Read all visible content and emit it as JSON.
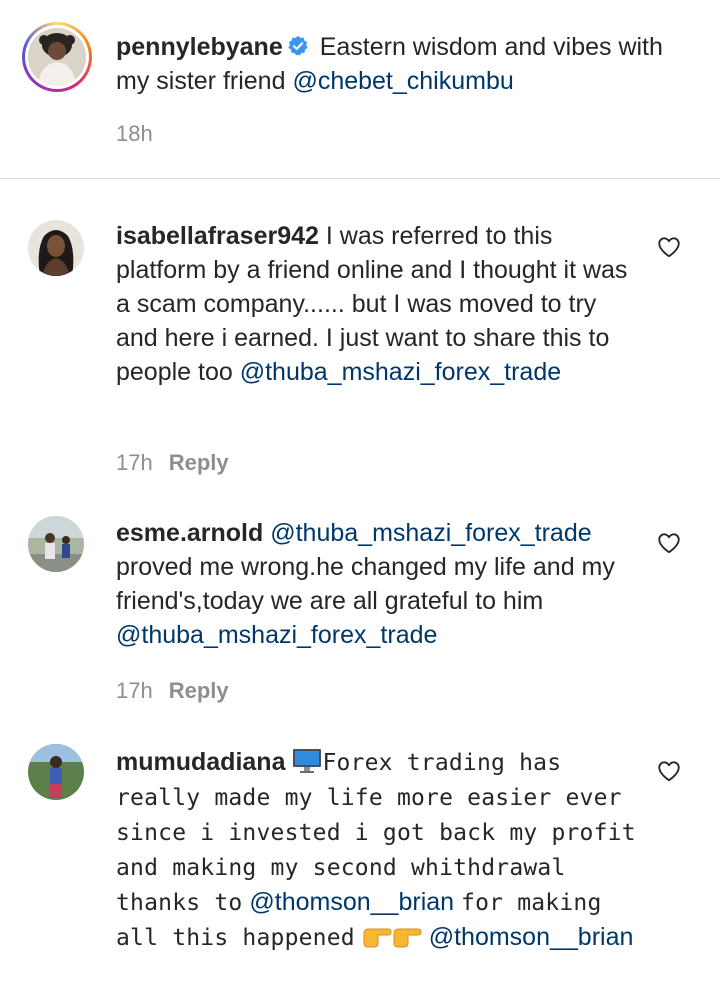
{
  "caption": {
    "username": "pennylebyane",
    "text": "Eastern wisdom and vibes with my sister friend",
    "mention": "@chebet_chikumbu",
    "time": "18h"
  },
  "comments": [
    {
      "username": "isabellafraser942",
      "text": "I was referred to this platform by a friend online and I thought it was a scam company...... but I was moved to try and here i earned. I just want to share this to people too",
      "mention": "@thuba_mshazi_forex_trade",
      "time": "17h",
      "reply_label": "Reply"
    },
    {
      "username": "esme.arnold",
      "mention_lead": "@thuba_mshazi_forex_trade",
      "text": "proved me wrong.he changed my life and my friend's,today we are all grateful to him",
      "mention": "@thuba_mshazi_forex_trade",
      "time": "17h",
      "reply_label": "Reply"
    },
    {
      "username": "mumudadiana",
      "text": "Forex trading has really made my life more easier ever since i invested i got back my profit and making my second whithdrawal thanks to",
      "mention": "@thomson__brian",
      "text_after": "for making all this happened",
      "mention_end": "@thomson__brian"
    }
  ],
  "icons": {
    "verified": "verified-badge-icon",
    "heart": "heart-outline-icon",
    "computer": "desktop-computer-emoji",
    "pointing": "pointing-right-emoji"
  },
  "colors": {
    "text": "#262626",
    "mention": "#00376b",
    "muted": "#8e8e8e",
    "verified": "#3897f0",
    "divider": "#dbdbdb"
  }
}
